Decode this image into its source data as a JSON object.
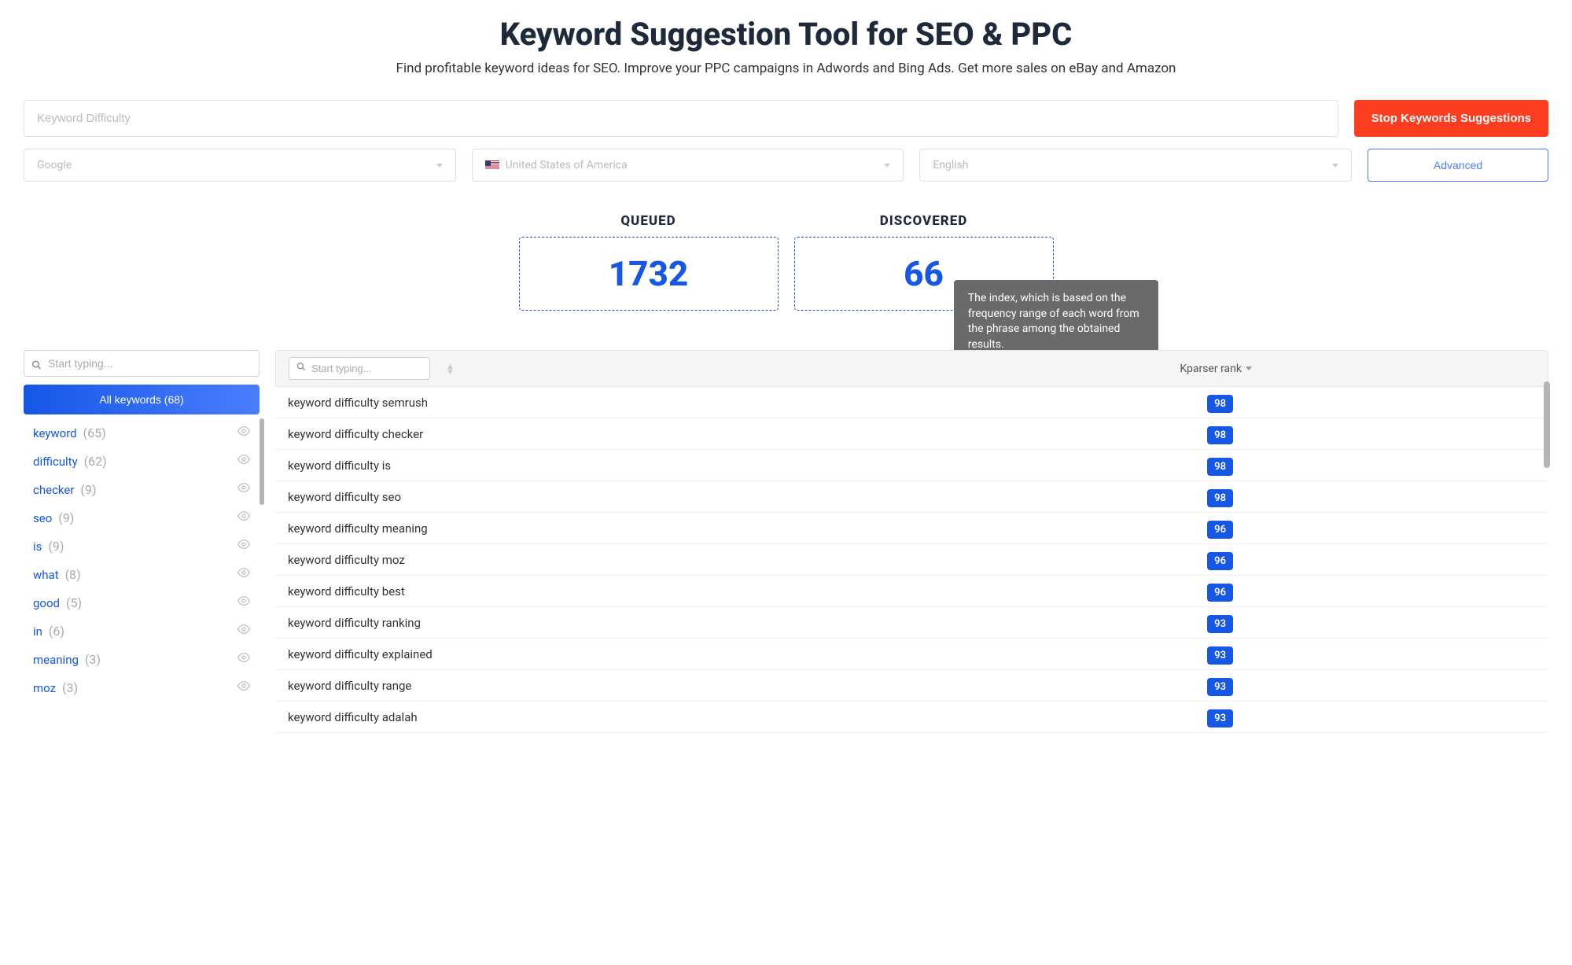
{
  "header": {
    "title": "Keyword Suggestion Tool for SEO & PPC",
    "subtitle": "Find profitable keyword ideas for SEO. Improve your PPC campaigns in Adwords and Bing Ads. Get more sales on eBay and Amazon"
  },
  "controls": {
    "keyword_placeholder": "Keyword Difficulty",
    "stop_button": "Stop Keywords Suggestions",
    "engine": "Google",
    "country": "United States of America",
    "language": "English",
    "advanced": "Advanced"
  },
  "stats": {
    "queued_label": "QUEUED",
    "queued_value": "1732",
    "discovered_label": "DISCOVERED",
    "discovered_value": "66"
  },
  "tooltip": "The index, which is based on the frequency range of each word from the phrase among the obtained results.",
  "sidebar": {
    "search_placeholder": "Start typing...",
    "all_keywords": "All keywords (68)",
    "items": [
      {
        "term": "keyword",
        "count": "(65)"
      },
      {
        "term": "difficulty",
        "count": "(62)"
      },
      {
        "term": "checker",
        "count": "(9)"
      },
      {
        "term": "seo",
        "count": "(9)"
      },
      {
        "term": "is",
        "count": "(9)"
      },
      {
        "term": "what",
        "count": "(8)"
      },
      {
        "term": "good",
        "count": "(5)"
      },
      {
        "term": "in",
        "count": "(6)"
      },
      {
        "term": "meaning",
        "count": "(3)"
      },
      {
        "term": "moz",
        "count": "(3)"
      }
    ]
  },
  "results": {
    "search_placeholder": "Start typing...",
    "rank_header": "Kparser rank",
    "rows": [
      {
        "keyword": "keyword difficulty semrush",
        "rank": "98"
      },
      {
        "keyword": "keyword difficulty checker",
        "rank": "98"
      },
      {
        "keyword": "keyword difficulty is",
        "rank": "98"
      },
      {
        "keyword": "keyword difficulty seo",
        "rank": "98"
      },
      {
        "keyword": "keyword difficulty meaning",
        "rank": "96"
      },
      {
        "keyword": "keyword difficulty moz",
        "rank": "96"
      },
      {
        "keyword": "keyword difficulty best",
        "rank": "96"
      },
      {
        "keyword": "keyword difficulty ranking",
        "rank": "93"
      },
      {
        "keyword": "keyword difficulty explained",
        "rank": "93"
      },
      {
        "keyword": "keyword difficulty range",
        "rank": "93"
      },
      {
        "keyword": "keyword difficulty adalah",
        "rank": "93"
      }
    ]
  }
}
